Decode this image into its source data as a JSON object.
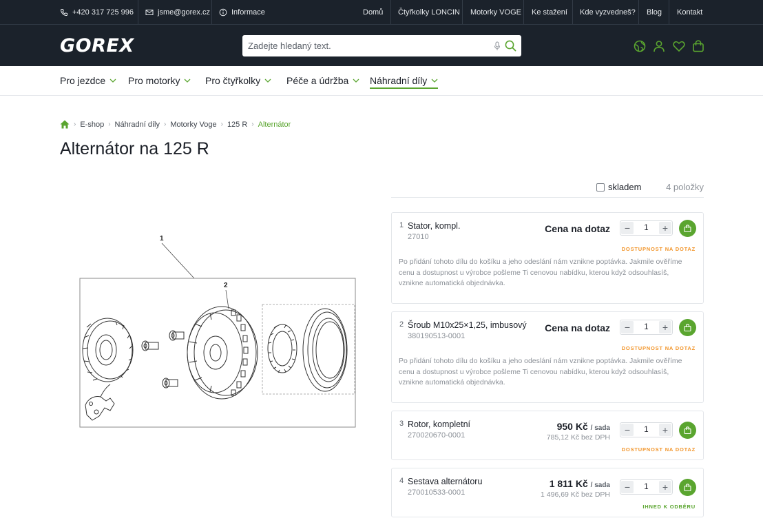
{
  "topbar": {
    "phone": "+420 317 725 996",
    "email": "jsme@gorex.cz",
    "info": "Informace",
    "links": [
      "Domů",
      "Čtyřkolky LONCIN",
      "Motorky VOGE",
      "Ke stažení",
      "Kde vyzvedneš?",
      "Blog",
      "Kontakt"
    ]
  },
  "header": {
    "logo": "GOREX",
    "search_placeholder": "Zadejte hledaný text."
  },
  "nav": {
    "items": [
      "Pro jezdce",
      "Pro motorky",
      "Pro čtyřkolky",
      "Péče a údržba",
      "Náhradní díly"
    ],
    "active": "Náhradní díly"
  },
  "breadcrumb": {
    "items": [
      "E-shop",
      "Náhradní díly",
      "Motorky Voge",
      "125 R"
    ],
    "current": "Alternátor"
  },
  "page": {
    "title": "Alternátor na 125 R"
  },
  "filter": {
    "stock_label": "skladem",
    "count": "4 položky"
  },
  "diagram": {
    "callouts": [
      "1",
      "2"
    ]
  },
  "parts": [
    {
      "num": "1",
      "name": "Stator, kompl.",
      "code": "27010",
      "price": "Cena na dotaz",
      "qty": "1",
      "availability": "DOSTUPNOST NA DOTAZ",
      "note": "Po přidání tohoto dílu do košíku a jeho odeslání nám vznikne poptávka. Jakmile ověříme cenu a dostupnost u výrobce pošleme Ti cenovou nabídku, kterou když odsouhlasíš, vznikne automatická objednávka."
    },
    {
      "num": "2",
      "name": "Šroub M10x25×1,25, imbusový",
      "code": "380190513-0001",
      "price": "Cena na dotaz",
      "qty": "1",
      "availability": "DOSTUPNOST NA DOTAZ",
      "note": "Po přidání tohoto dílu do košíku a jeho odeslání nám vznikne poptávka. Jakmile ověříme cenu a dostupnost u výrobce pošleme Ti cenovou nabídku, kterou když odsouhlasíš, vznikne automatická objednávka."
    },
    {
      "num": "3",
      "name": "Rotor, kompletní",
      "code": "270020670-0001",
      "price": "950 Kč",
      "unit": "/ sada",
      "price_net": "785,12 Kč bez DPH",
      "qty": "1",
      "availability": "DOSTUPNOST NA DOTAZ"
    },
    {
      "num": "4",
      "name": "Sestava alternátoru",
      "code": "270010533-0001",
      "price": "1 811 Kč",
      "unit": "/ sada",
      "price_net": "1 496,69 Kč bez DPH",
      "qty": "1",
      "availability": "IHNED K ODBĚRU"
    }
  ],
  "colors": {
    "accent": "#5aa52f",
    "dark": "#1b222b",
    "orange": "#f2952a"
  }
}
